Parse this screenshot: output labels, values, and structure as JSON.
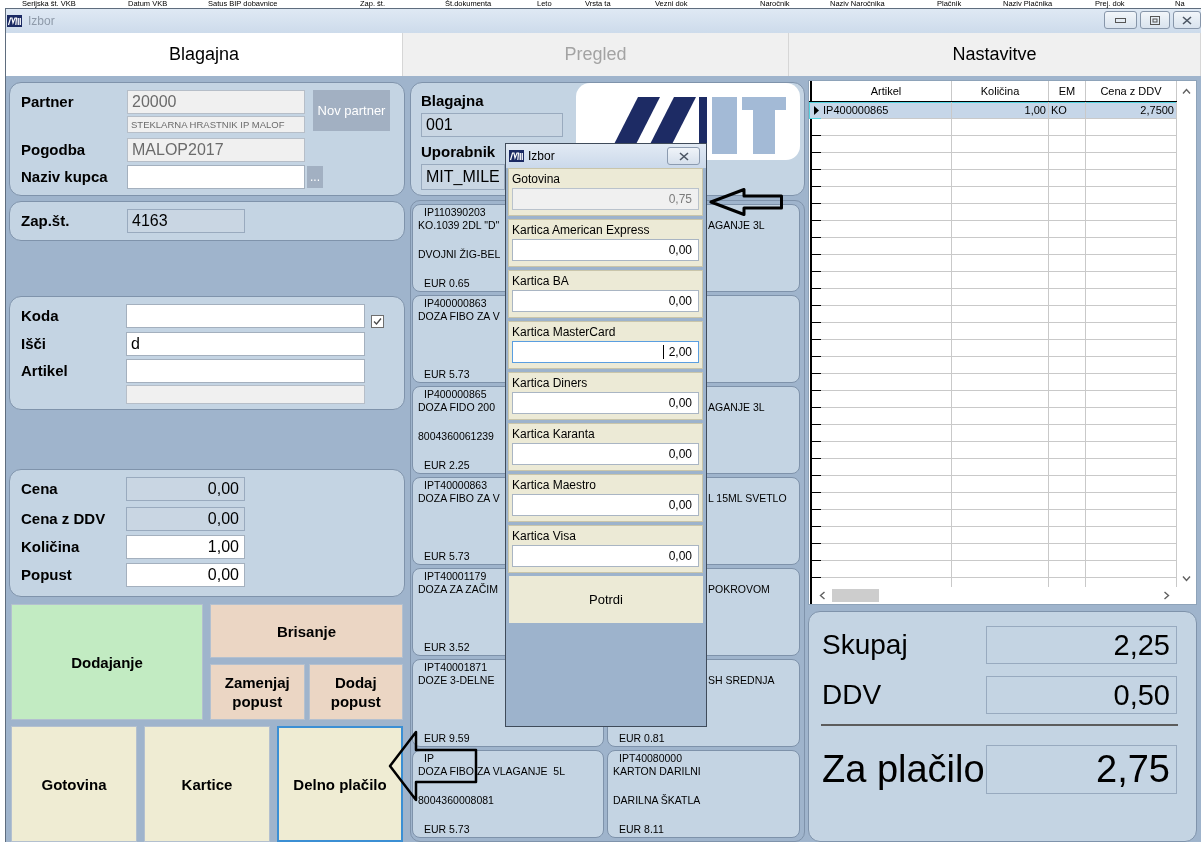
{
  "background_window": {
    "column_headers": [
      "Serijska št. VKB",
      "Datum VKB",
      "Satus BIP dobavnice",
      "Zap. št.",
      "Št.dokumenta",
      "Leto",
      "Vrsta ta",
      "Vezni dok",
      "Naročnik",
      "Naziv Naročnika",
      "Plačnik",
      "Naziv Plačnika",
      "Prej. dok",
      "Na"
    ]
  },
  "window": {
    "title": "Izbor",
    "active": false
  },
  "tabs": [
    {
      "label": "Blagajna",
      "selected": true,
      "disabled": false
    },
    {
      "label": "Pregled",
      "selected": false,
      "disabled": true
    },
    {
      "label": "Nastavitve",
      "selected": false,
      "disabled": false
    }
  ],
  "partner_panel": {
    "partner_label": "Partner",
    "partner_code": "20000",
    "partner_name": "STEKLARNA HRASTNIK IP MALOF",
    "new_partner_button": "Nov partner",
    "contract_label": "Pogodba",
    "contract": "MALOP2017",
    "customer_label": "Naziv kupca",
    "browse_button": "..."
  },
  "sequence_panel": {
    "label": "Zap.št.",
    "value": "4163"
  },
  "search_panel": {
    "code_label": "Koda",
    "code_checked": true,
    "search_label": "Išči",
    "search_value": "d",
    "article_label": "Artikel"
  },
  "price_panel": {
    "rows": [
      {
        "label": "Cena",
        "value": "0,00",
        "editable": false
      },
      {
        "label": "Cena z DDV",
        "value": "0,00",
        "editable": false
      },
      {
        "label": "Količina",
        "value": "1,00",
        "editable": true
      },
      {
        "label": "Popust",
        "value": "0,00",
        "editable": true
      }
    ]
  },
  "action_buttons": [
    {
      "label": "Dodajanje",
      "kind": "add"
    },
    {
      "label": "Brisanje",
      "kind": "delete"
    },
    {
      "label": "Zamenjaj popust",
      "kind": "replace_discount"
    },
    {
      "label": "Dodaj popust",
      "kind": "add_discount"
    }
  ],
  "payment_buttons": [
    {
      "label": "Gotovina",
      "focused": false
    },
    {
      "label": "Kartice",
      "focused": false
    },
    {
      "label": "Delno plačilo",
      "focused": true
    }
  ],
  "register_panel": {
    "register_label": "Blagajna",
    "register": "001",
    "user_label": "Uporabnik",
    "user": "MIT_MILE"
  },
  "product_rows": [
    {
      "left": {
        "code": "IP110390203",
        "name": "KO.1039 2DL \"D\"",
        "note": "DVOJNI ŽIG-BEL",
        "price": "EUR 0.65"
      },
      "right": {
        "name": "AGANJE 3L"
      }
    },
    {
      "left": {
        "code": "IP400000863",
        "name": "DOZA FIBO ZA V",
        "price": "EUR 5.73"
      }
    },
    {
      "left": {
        "code": "IP400000865",
        "name": "DOZA FIDO 200",
        "note": "8004360061239",
        "price": "EUR 2.25"
      },
      "right": {
        "name": "AGANJE 3L"
      }
    },
    {
      "left": {
        "code": "IPT40000863",
        "name": "DOZA FIBO ZA V",
        "price": "EUR 5.73"
      },
      "right": {
        "name": "L 15ML SVETLO"
      }
    },
    {
      "left": {
        "code": "IPT40001179",
        "name": "DOZA ZA ZAČIM",
        "price": "EUR 3.52"
      },
      "right": {
        "name": "POKROVOM"
      }
    },
    {
      "left": {
        "code": "IPT40001871",
        "name": "DOZE 3-DELNE",
        "price": "EUR 9.59"
      },
      "right": {
        "name": "SH SREDNJA",
        "price": "EUR 0.81"
      }
    },
    {
      "left": {
        "code": "IP",
        "name": "DOZA FIBO ZA VLAGANJE  5L",
        "note": "8004360008081",
        "price": "EUR 5.73"
      },
      "right": {
        "code": "IPT40080000",
        "name": "KARTON DARILNI",
        "note": "DARILNA ŠKATLA",
        "price": "EUR 8.11"
      }
    }
  ],
  "table": {
    "columns": [
      "Artikel",
      "Količina",
      "EM",
      "Cena z DDV"
    ],
    "rows": [
      {
        "cells": [
          "IP400000865",
          "1,00",
          "KO",
          "2,7500"
        ],
        "selected": true
      }
    ]
  },
  "totals": [
    {
      "label": "Skupaj",
      "value": "2,25",
      "kind": "sum"
    },
    {
      "label": "DDV",
      "value": "0,50",
      "kind": "sum"
    },
    {
      "label": "Za plačilo",
      "value": "2,75",
      "kind": "due"
    }
  ],
  "payment_dialog": {
    "title": "Izbor",
    "methods": [
      {
        "label": "Gotovina",
        "value": "0,75",
        "disabled": true,
        "focused": false
      },
      {
        "label": "Kartica American Express",
        "value": "0,00",
        "disabled": false,
        "focused": false
      },
      {
        "label": "Kartica BA",
        "value": "0,00",
        "disabled": false,
        "focused": false
      },
      {
        "label": "Kartica MasterCard",
        "value": "2,00",
        "disabled": false,
        "focused": true
      },
      {
        "label": "Kartica Diners",
        "value": "0,00",
        "disabled": false,
        "focused": false
      },
      {
        "label": "Kartica Karanta",
        "value": "0,00",
        "disabled": false,
        "focused": false
      },
      {
        "label": "Kartica Maestro",
        "value": "0,00",
        "disabled": false,
        "focused": false
      },
      {
        "label": "Kartica Visa",
        "value": "0,00",
        "disabled": false,
        "focused": false
      }
    ],
    "confirm_button": "Potrdi"
  }
}
